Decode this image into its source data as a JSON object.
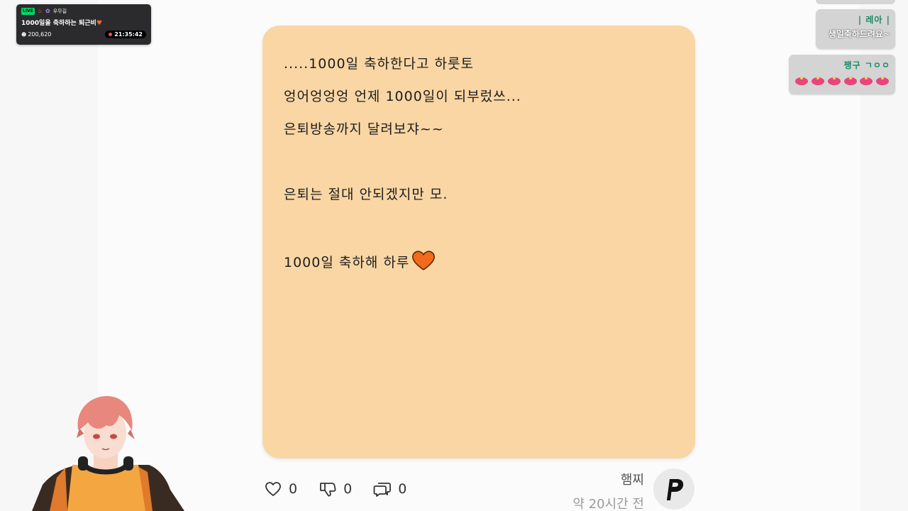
{
  "stream": {
    "badge": "LIVE",
    "streamer_name": "우무길",
    "title": "1000일을 축하하는 퇴근비",
    "viewers": "200,620",
    "timer": "21:35:42"
  },
  "chat": [
    {
      "name": "| 레아 |",
      "message": "생일축하드려요~"
    },
    {
      "name": "팽구 ㄱㅇㅇ",
      "message": ""
    }
  ],
  "letter": {
    "lines": [
      ".....1000일 축하한다고 하룻토",
      "엉어엉엉엉 언제 1000일이 되부렀쓰...",
      "은퇴방송까지 달려보쟈~~",
      "",
      "은퇴는 절대 안되겠지만 모.",
      "",
      "1000일 축하해 하루"
    ],
    "background_color": "#f9d6a4",
    "heart_color": "#f26a1b"
  },
  "reactions": {
    "likes": "0",
    "dislikes": "0",
    "comments": "0"
  },
  "author": {
    "name": "햄찌",
    "time": "약 20시간 전",
    "avatar_letter": "P"
  }
}
